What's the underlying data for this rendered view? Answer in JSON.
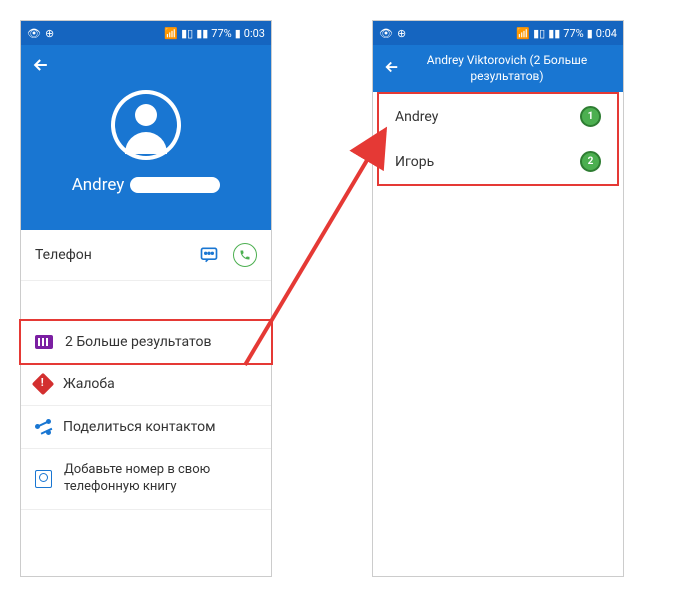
{
  "statusbar": {
    "battery": "77%",
    "time1": "0:03",
    "time2": "0:04"
  },
  "contact": {
    "name": "Andrey",
    "phone_label": "Телефон",
    "more_results": "2 Больше результатов",
    "complaint": "Жалоба",
    "share": "Поделиться контактом",
    "add_book": "Добавьте номер в свою телефонную книгу"
  },
  "results": {
    "title": "Andrey Viktorovich (2 Больше результатов)",
    "items": [
      "Andrey",
      "Игорь"
    ]
  }
}
